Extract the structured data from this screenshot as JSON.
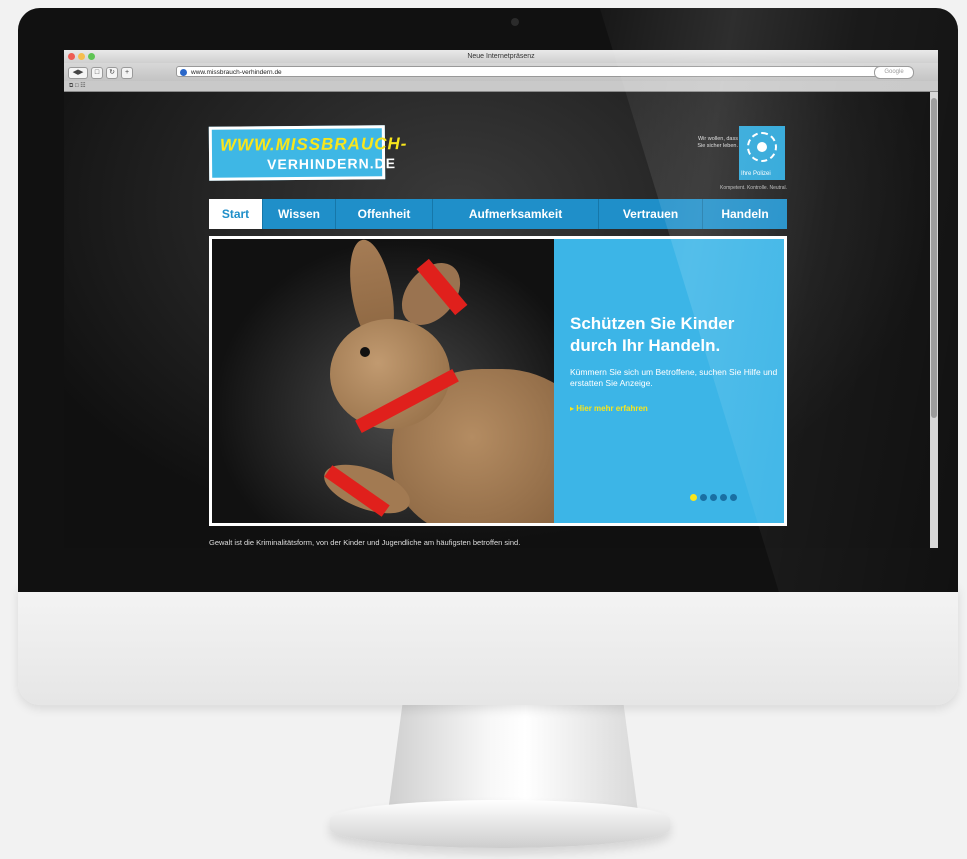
{
  "browser": {
    "window_title": "Neue Internetpräsenz",
    "url": "www.missbrauch-verhindern.de",
    "search_placeholder": "Google",
    "bookmarks_label": "⧉ □ ☷"
  },
  "site": {
    "logo": {
      "line1": "WWW.MISSBRAUCH-",
      "line2": "VERHINDERN.DE"
    },
    "police": {
      "text": "Wir wollen, dass Sie sicher leben.",
      "badge_label": "Ihre Polizei",
      "slogan": "Kompetent. Kontrolle. Neutral."
    },
    "nav": [
      {
        "label": "Start"
      },
      {
        "label": "Wissen"
      },
      {
        "label": "Offenheit"
      },
      {
        "label": "Aufmerksamkeit"
      },
      {
        "label": "Vertrauen"
      },
      {
        "label": "Handeln"
      }
    ],
    "hero": {
      "headline": "Schützen Sie Kinder durch Ihr Handeln.",
      "subtext": "Kümmern Sie sich um Betroffene, suchen Sie Hilfe und erstatten Sie Anzeige.",
      "cta": "▸ Hier mehr erfahren",
      "slides": 5,
      "active_slide": 1
    },
    "intro": "Gewalt ist die Kriminalitätsform, von der Kinder und Jugendliche am häufigsten betroffen sind."
  }
}
